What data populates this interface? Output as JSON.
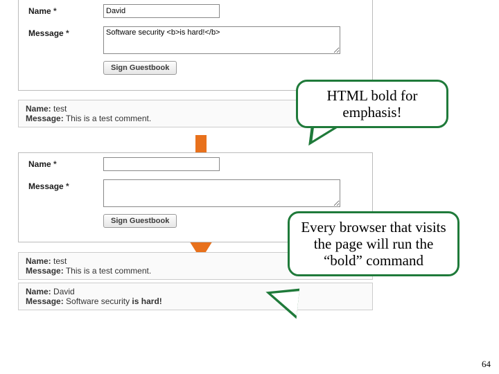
{
  "form1": {
    "name_label": "Name",
    "name_value": "David",
    "msg_label": "Message",
    "msg_value": "Software security <b>is hard!</b>",
    "submit": "Sign Guestbook"
  },
  "form2": {
    "name_label": "Name",
    "name_value": "",
    "msg_label": "Message",
    "msg_value": "",
    "submit": "Sign Guestbook"
  },
  "entries": {
    "e1_name_lbl": "Name:",
    "e1_name_val": "test",
    "e1_msg_lbl": "Message:",
    "e1_msg_val": "This is a test comment.",
    "e2_name_lbl": "Name:",
    "e2_name_val": "test",
    "e2_msg_lbl": "Message:",
    "e2_msg_val": "This is a test comment.",
    "e3_name_lbl": "Name:",
    "e3_name_val": "David",
    "e3_msg_lbl": "Message:",
    "e3_msg_prefix": "Software security ",
    "e3_msg_bold": "is hard!"
  },
  "callouts": {
    "c1": "HTML bold for emphasis!",
    "c2": "Every browser that visits the page will run the “bold” command"
  },
  "page": "64",
  "star": "*"
}
